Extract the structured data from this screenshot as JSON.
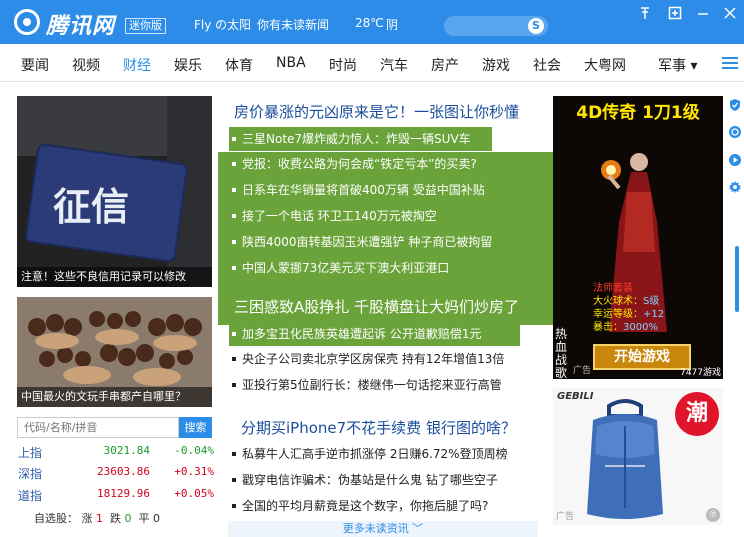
{
  "titlebar": {
    "logo_text": "腾讯网",
    "edition": "迷你版",
    "user": "Fly の太阳",
    "news_notice": "你有未读新闻",
    "temperature": "28℃",
    "weather": "阴",
    "search_placeholder": "",
    "search_icon_glyph": "S",
    "icons": [
      "pin-icon",
      "new-window-icon",
      "minimize-icon",
      "close-icon"
    ]
  },
  "nav": {
    "items": [
      "要闻",
      "视频",
      "财经",
      "娱乐",
      "体育",
      "NBA",
      "时尚",
      "汽车",
      "房产",
      "游戏",
      "社会",
      "大粤网",
      "军事 ▾"
    ],
    "active_index": 2
  },
  "left": {
    "card1_caption": "注意！这些不良信用记录可以修改",
    "card1_word": "征信",
    "card2_caption": "中国最火的文玩手串都产自哪里？",
    "stock_placeholder": "代码/名称/拼音",
    "stock_button": "搜索",
    "stocks": [
      {
        "name": "上指",
        "value": "3021.84",
        "change": "-0.04%",
        "color": "#1a9a2a"
      },
      {
        "name": "深指",
        "value": "23603.86",
        "change": "+0.31%",
        "color": "#d0021b"
      },
      {
        "name": "道指",
        "value": "18129.96",
        "change": "+0.05%",
        "color": "#d0021b"
      }
    ],
    "watch": {
      "label": "自选股：",
      "up_label": "涨",
      "up": "1",
      "down_label": "跌",
      "down": "0",
      "flat_label": "平",
      "flat": "0"
    }
  },
  "center": {
    "headline1": "房价暴涨的元凶原来是它！一张图让你秒懂",
    "green_items": [
      "三星Note7爆炸威力惊人：炸毁一辆SUV车",
      "党报：收费公路为何会成“铁定亏本”的买卖?",
      "日系车在华销量将首破400万辆 受益中国补贴",
      "接了一个电话 环卫工140万元被掏空",
      "陕西4000亩转基因玉米遭强铲 种子商已被拘留",
      "中国人蒙挪73亿美元买下澳大利亚港口"
    ],
    "headline2": "三困惑致A股挣扎 千股横盘让大妈们炒房了",
    "green_item_last": "加多宝丑化民族英雄遭起诉 公开道歉赔偿1元",
    "items_a": [
      "央企子公司卖北京学区房保壳 持有12年增值13倍",
      "亚投行第5位副行长：楼继伟一句话挖来亚行高管"
    ],
    "headline3": "分期买iPhone7不花手续费 银行图的啥？",
    "items_b": [
      "私募牛人汇高手逆市抓涨停 2日赚6.72%登顶周榜",
      "戳穿电信诈骗术：伪基站是什么鬼 钻了哪些空子",
      "全国的平均月薪竟是这个数字，你拖后腿了吗?"
    ],
    "more_news": "更多未读资讯 ﹀"
  },
  "ads": {
    "game": {
      "title": "4D传奇 1刀1级",
      "set_name": "法师套装",
      "stats": [
        {
          "label": "大火球术：",
          "value": "S级"
        },
        {
          "label": "幸运等级：",
          "value": "+12"
        },
        {
          "label": "暴击：",
          "value": "3000%"
        }
      ],
      "button": "开始游戏",
      "side_text": "热血战歌",
      "count_text": "7477游戏",
      "ad_tag": "广告"
    },
    "bag": {
      "brand": "GEBILI",
      "badge": "潮",
      "ad_tag": "广告",
      "pin_glyph": "℗"
    }
  },
  "sidebar_icons": [
    "shield-icon",
    "refresh-icon",
    "play-icon",
    "settings-icon"
  ],
  "colors": {
    "brand_blue": "#2d8ce8",
    "green_block": "#6aa33a",
    "headline_blue": "#1a4e9c",
    "up_red": "#d0021b",
    "down_green": "#1a9a2a"
  }
}
